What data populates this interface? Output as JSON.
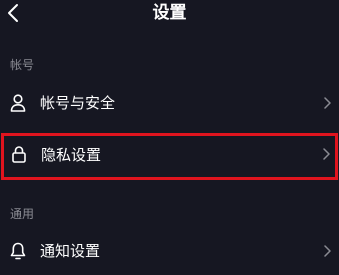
{
  "nav": {
    "title": "设置",
    "back_icon": "chevron-left-icon"
  },
  "sections": [
    {
      "header": "帐号",
      "rows": [
        {
          "label": "帐号与安全",
          "icon": "user-icon",
          "chevron": "chevron-right-icon",
          "highlighted": false
        },
        {
          "label": "隐私设置",
          "icon": "lock-icon",
          "chevron": "chevron-right-icon",
          "highlighted": true
        }
      ]
    },
    {
      "header": "通用",
      "rows": [
        {
          "label": "通知设置",
          "icon": "bell-icon",
          "chevron": "chevron-right-icon",
          "highlighted": false
        }
      ]
    }
  ],
  "colors": {
    "background": "#161722",
    "text": "#ffffff",
    "section_header": "#8a8b93",
    "chevron": "#8a8b93",
    "highlight_border": "#e0141e"
  }
}
